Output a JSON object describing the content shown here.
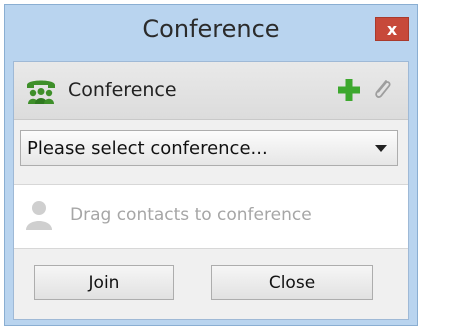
{
  "window": {
    "title": "Conference",
    "close_label": "x"
  },
  "header": {
    "label": "Conference",
    "icon": "conference-phone-icon",
    "add_icon": "plus-icon",
    "attach_icon": "paperclip-icon"
  },
  "conference_select": {
    "value": "Please select conference..."
  },
  "drop_zone": {
    "icon": "person-icon",
    "text": "Drag contacts to conference"
  },
  "buttons": {
    "join": "Join",
    "close": "Close"
  },
  "colors": {
    "frame": "#b9d4ef",
    "close_button": "#c7493a",
    "add_icon": "#3da82e",
    "conference_icon": "#3e8f2a"
  }
}
